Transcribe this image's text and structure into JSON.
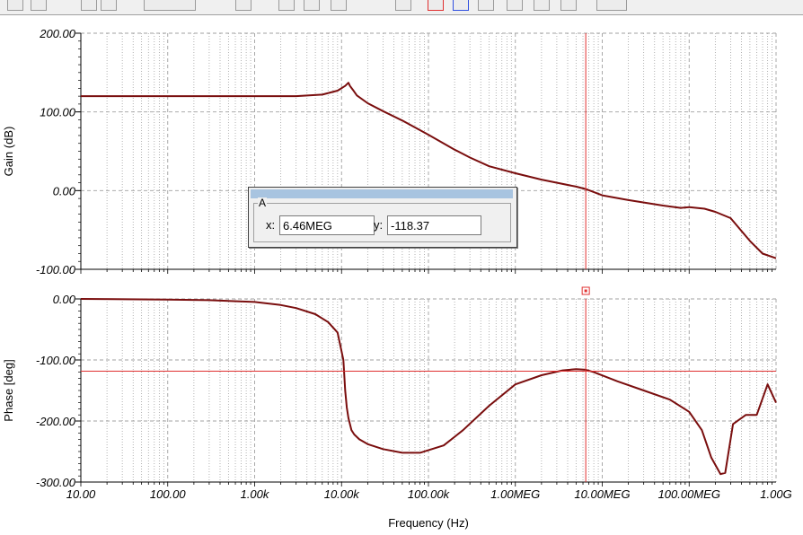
{
  "colors": {
    "trace": "#7a0e0e",
    "cursor": "#e03030",
    "grid": "#a0a0a0",
    "titlebar": "#a8c4e0"
  },
  "toolbar": {
    "icons": [
      "toolbar-button",
      "toolbar-button",
      "grid-icon",
      "zoom-icon",
      "zoom-dropdown-icon",
      "scale-icon",
      "axis-icon",
      "axis-y-icon",
      "legend-icon",
      "refresh-icon",
      "cursor-a-icon",
      "cursor-b-icon",
      "cursor-c-icon",
      "pointer-icon",
      "play-icon",
      "stepper-icon"
    ]
  },
  "cursor_readout": {
    "group_label": "A",
    "x_label": "x:",
    "x_value": "6.46MEG",
    "y_label": "y:",
    "y_value": "-118.37"
  },
  "chart_data": [
    {
      "type": "line",
      "title": "",
      "ylabel": "Gain (dB)",
      "xlabel": "",
      "xscale": "log",
      "xlim": [
        10,
        1000000000
      ],
      "ylim": [
        -100,
        200
      ],
      "grid": true,
      "ytick_labels": [
        "200.00",
        "100.00",
        "0.00",
        "-100.00"
      ],
      "yticks": [
        200,
        100,
        0,
        -100
      ],
      "series": [
        {
          "x": [
            10,
            100,
            1000,
            3000,
            6000,
            9000,
            11000,
            12000,
            12500,
            13500,
            15000,
            20000,
            30000,
            50000,
            100000,
            200000,
            300000,
            500000,
            1000000,
            2000000,
            5000000,
            6460000,
            10000000,
            20000000,
            50000000,
            80000000,
            100000000,
            150000000,
            200000000,
            300000000,
            500000000,
            700000000,
            1000000000
          ],
          "y": [
            120,
            120,
            120,
            120,
            122,
            127,
            133,
            137,
            133,
            128,
            121,
            111,
            101,
            89,
            71,
            52,
            42,
            31,
            22,
            14,
            5,
            2,
            -6,
            -12,
            -19,
            -22,
            -21,
            -23,
            -27,
            -35,
            -64,
            -80,
            -86
          ]
        }
      ]
    },
    {
      "type": "line",
      "title": "",
      "ylabel": "Phase [deg]",
      "xlabel": "Frequency (Hz)",
      "xscale": "log",
      "xlim": [
        10,
        1000000000
      ],
      "ylim": [
        -300,
        0
      ],
      "grid": true,
      "ytick_labels": [
        "0.00",
        "-100.00",
        "-200.00",
        "-300.00"
      ],
      "yticks": [
        0,
        -100,
        -200,
        -300
      ],
      "xtick_labels": [
        "10.00",
        "100.00",
        "1.00k",
        "10.00k",
        "100.00k",
        "1.00MEG",
        "10.00MEG",
        "100.00MEG",
        "1.00G"
      ],
      "xticks": [
        10,
        100,
        1000,
        10000,
        100000,
        1000000,
        10000000,
        100000000,
        1000000000
      ],
      "series": [
        {
          "x": [
            10,
            100,
            300,
            1000,
            2000,
            3000,
            5000,
            7000,
            9000,
            10500,
            11000,
            11500,
            12000,
            13000,
            14000,
            16000,
            20000,
            30000,
            50000,
            80000,
            150000,
            250000,
            500000,
            1000000,
            2000000,
            3500000,
            5000000,
            6460000,
            8000000,
            15000000,
            30000000,
            60000000,
            100000000,
            140000000,
            180000000,
            230000000,
            260000000,
            320000000,
            450000000,
            600000000,
            800000000,
            1000000000
          ],
          "y": [
            0,
            -1,
            -2,
            -5,
            -10,
            -15,
            -25,
            -38,
            -55,
            -100,
            -150,
            -178,
            -195,
            -215,
            -222,
            -230,
            -238,
            -246,
            -252,
            -252,
            -240,
            -215,
            -175,
            -140,
            -125,
            -117,
            -115,
            -116,
            -120,
            -135,
            -150,
            -165,
            -185,
            -215,
            -260,
            -287,
            -285,
            -205,
            -190,
            -190,
            -140,
            -170
          ]
        }
      ]
    }
  ],
  "cursor": {
    "x": 6460000,
    "y": -118.37
  }
}
